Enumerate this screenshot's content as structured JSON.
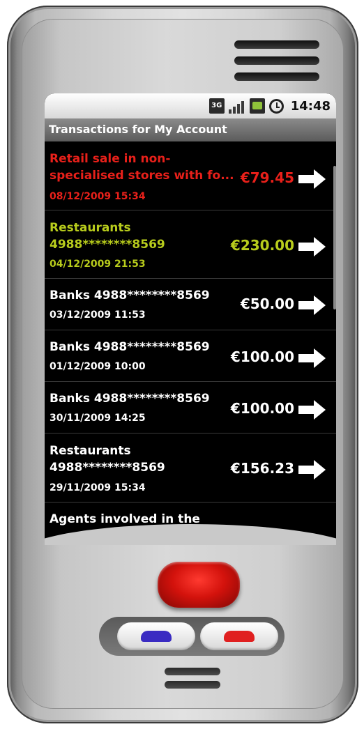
{
  "statusbar": {
    "time": "14:48",
    "network": "3G"
  },
  "app": {
    "title": "Transactions for My Account"
  },
  "transactions": [
    {
      "description": "Retail sale in non-\nspecialised stores with fo...",
      "date": "08/12/2009 15:34",
      "amount": "€79.45",
      "color": "#e8201a"
    },
    {
      "description": "Restaurants\n4988********8569",
      "date": "04/12/2009 21:53",
      "amount": "€230.00",
      "color": "#b8cc1c"
    },
    {
      "description": "Banks 4988********8569",
      "date": "03/12/2009 11:53",
      "amount": "€50.00",
      "color": "#ffffff"
    },
    {
      "description": "Banks 4988********8569",
      "date": "01/12/2009 10:00",
      "amount": "€100.00",
      "color": "#ffffff"
    },
    {
      "description": "Banks 4988********8569",
      "date": "30/11/2009 14:25",
      "amount": "€100.00",
      "color": "#ffffff"
    },
    {
      "description": "Restaurants\n4988********8569",
      "date": "29/11/2009 15:34",
      "amount": "€156.23",
      "color": "#ffffff"
    },
    {
      "description": "Agents involved in the",
      "date": "",
      "amount": "",
      "color": "#ffffff"
    }
  ]
}
